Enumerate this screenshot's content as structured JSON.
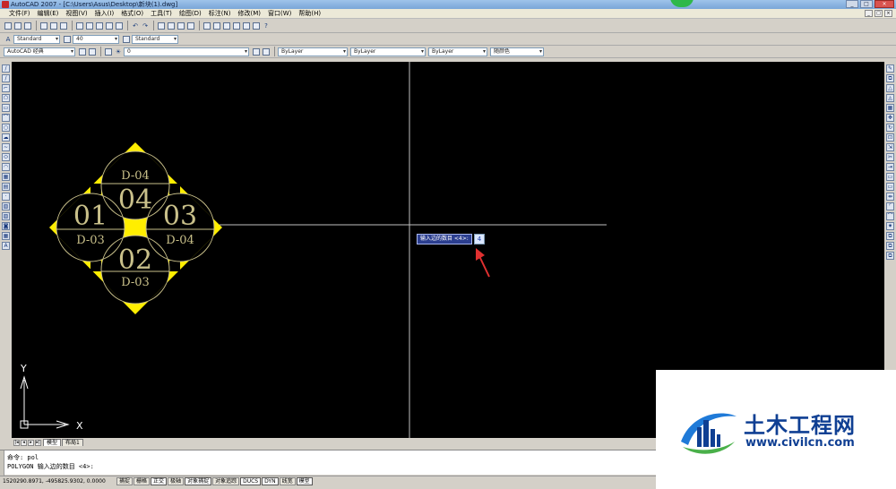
{
  "window": {
    "title": "AutoCAD 2007 - [C:\\Users\\Asus\\Desktop\\新块(1).dwg]"
  },
  "menu": [
    "文件(F)",
    "编辑(E)",
    "视图(V)",
    "插入(I)",
    "格式(O)",
    "工具(T)",
    "绘图(D)",
    "标注(N)",
    "修改(M)",
    "窗口(W)",
    "帮助(H)"
  ],
  "styles_toolbar": {
    "text_style": "Standard",
    "dim_style": "40",
    "table_style": "Standard"
  },
  "layers_toolbar": {
    "workspace": "AutoCAD 经典",
    "layer": "0",
    "color": "ByLayer",
    "linetype": "ByLayer",
    "lineweight": "ByLayer",
    "plotstyle": "随颜色"
  },
  "drawing": {
    "circles": [
      {
        "number": "04",
        "label": "D-04"
      },
      {
        "number": "01",
        "label": "D-03"
      },
      {
        "number": "03",
        "label": "D-04"
      },
      {
        "number": "02",
        "label": "D-03"
      }
    ],
    "ucs_y": "Y",
    "ucs_x": "X"
  },
  "dynamic_input": {
    "prompt": "输入边的数目 <4>:",
    "value": "4"
  },
  "tabs": [
    "模型",
    "布局1"
  ],
  "command": {
    "line1": "命令: pol",
    "line2": "POLYGON 输入边的数目 <4>:"
  },
  "status": {
    "coords": "1520290.8971, -495825.9302, 0.0000",
    "buttons": [
      {
        "label": "捕捉",
        "on": false
      },
      {
        "label": "栅格",
        "on": false
      },
      {
        "label": "正交",
        "on": true
      },
      {
        "label": "极轴",
        "on": false
      },
      {
        "label": "对象捕捉",
        "on": true
      },
      {
        "label": "对象追踪",
        "on": false
      },
      {
        "label": "DUCS",
        "on": true
      },
      {
        "label": "DYN",
        "on": true
      },
      {
        "label": "线宽",
        "on": false
      },
      {
        "label": "模型",
        "on": true
      }
    ]
  },
  "watermark": {
    "title": "土木工程网",
    "url": "www.civilcn.com"
  },
  "colors": {
    "canvas": "#000000",
    "drawing_yellow": "#ffee00",
    "drawing_text": "#c9c08a",
    "crosshair": "#bfbfbf",
    "accent_red": "#e03030"
  }
}
